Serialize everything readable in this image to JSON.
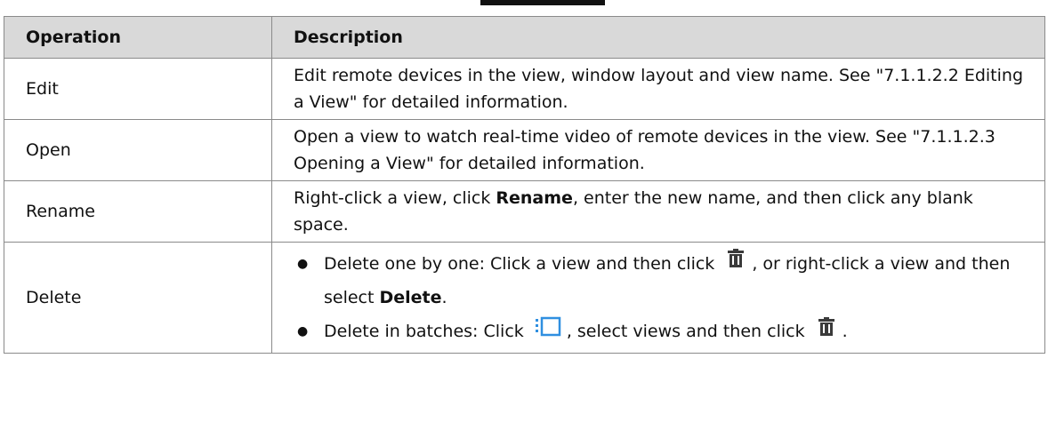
{
  "table": {
    "headers": {
      "operation": "Operation",
      "description": "Description"
    },
    "rows": [
      {
        "operation": "Edit",
        "description": "Edit remote devices in the view, window layout and view name. See \"7.1.1.2.2 Editing a View\" for detailed information."
      },
      {
        "operation": "Open",
        "description": "Open a view to watch real-time video of remote devices in the view. See \"7.1.1.2.3 Opening a View\" for detailed information."
      },
      {
        "operation": "Rename",
        "description": {
          "part1": "Right-click a view, click ",
          "bold1": "Rename",
          "part2": ", enter the new name, and then click any blank space."
        }
      },
      {
        "operation": "Delete",
        "bullets": [
          {
            "bullet": "●",
            "part1": "Delete one by one: Click a view and then click ",
            "part2": ", or right-click a view and then select ",
            "bold": "Delete",
            "part3": "."
          },
          {
            "bullet": "●",
            "part1": "Delete in batches: Click ",
            "part2": ", select views and then click ",
            "part3": "."
          }
        ]
      }
    ]
  },
  "icons": {
    "delete": "trash-icon",
    "batch": "batch-select-icon"
  },
  "colors": {
    "header_bg": "#d9d9d9",
    "border": "#8a8a8a",
    "icon_blue": "#2f8fe0",
    "icon_dark": "#3a3a3a"
  }
}
